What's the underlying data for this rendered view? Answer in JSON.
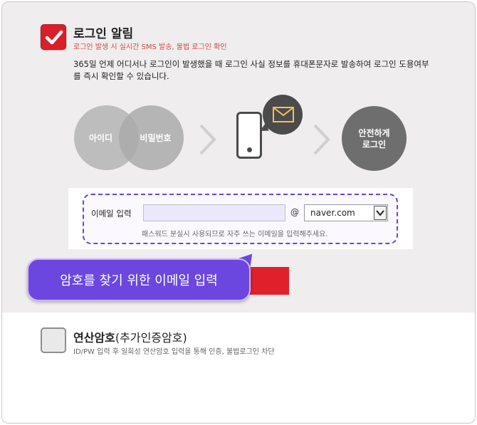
{
  "login_alert": {
    "checked": true,
    "title": "로그인 알림",
    "subtitle": "로그인 발생 시 실시간 SMS 발송, 불법 로그인 확인",
    "description": "365일 언제 어디서나 로그인이 발생했을 때 로그인 사실 정보를 휴대폰문자로 발송하여 로그인 도용여부를 즉시 확인할 수 있습니다."
  },
  "flow": {
    "id_label": "아이디",
    "pw_label": "비밀번호",
    "safe_label_line1": "안전하게",
    "safe_label_line2": "로그인"
  },
  "email_form": {
    "label": "이메일 입력",
    "value": "",
    "at": "@",
    "domain_selected": "naver.com",
    "hint": "패스워드 분실시 사용되므로 자주 쓰는 이메일을 입력해주세요."
  },
  "tooltip": {
    "text": "암호를 찾기 위한 이메일 입력"
  },
  "otp_option": {
    "checked": false,
    "title": "연산암호",
    "title_suffix": "(추가인증암호)",
    "subtitle": "ID/PW 입력 후 일회성 연산암호 입력을 통해 인증, 불법로그인 차단"
  },
  "colors": {
    "accent_red": "#e0202a",
    "tooltip_purple": "#6b47e0",
    "section_bg": "#efeded"
  }
}
